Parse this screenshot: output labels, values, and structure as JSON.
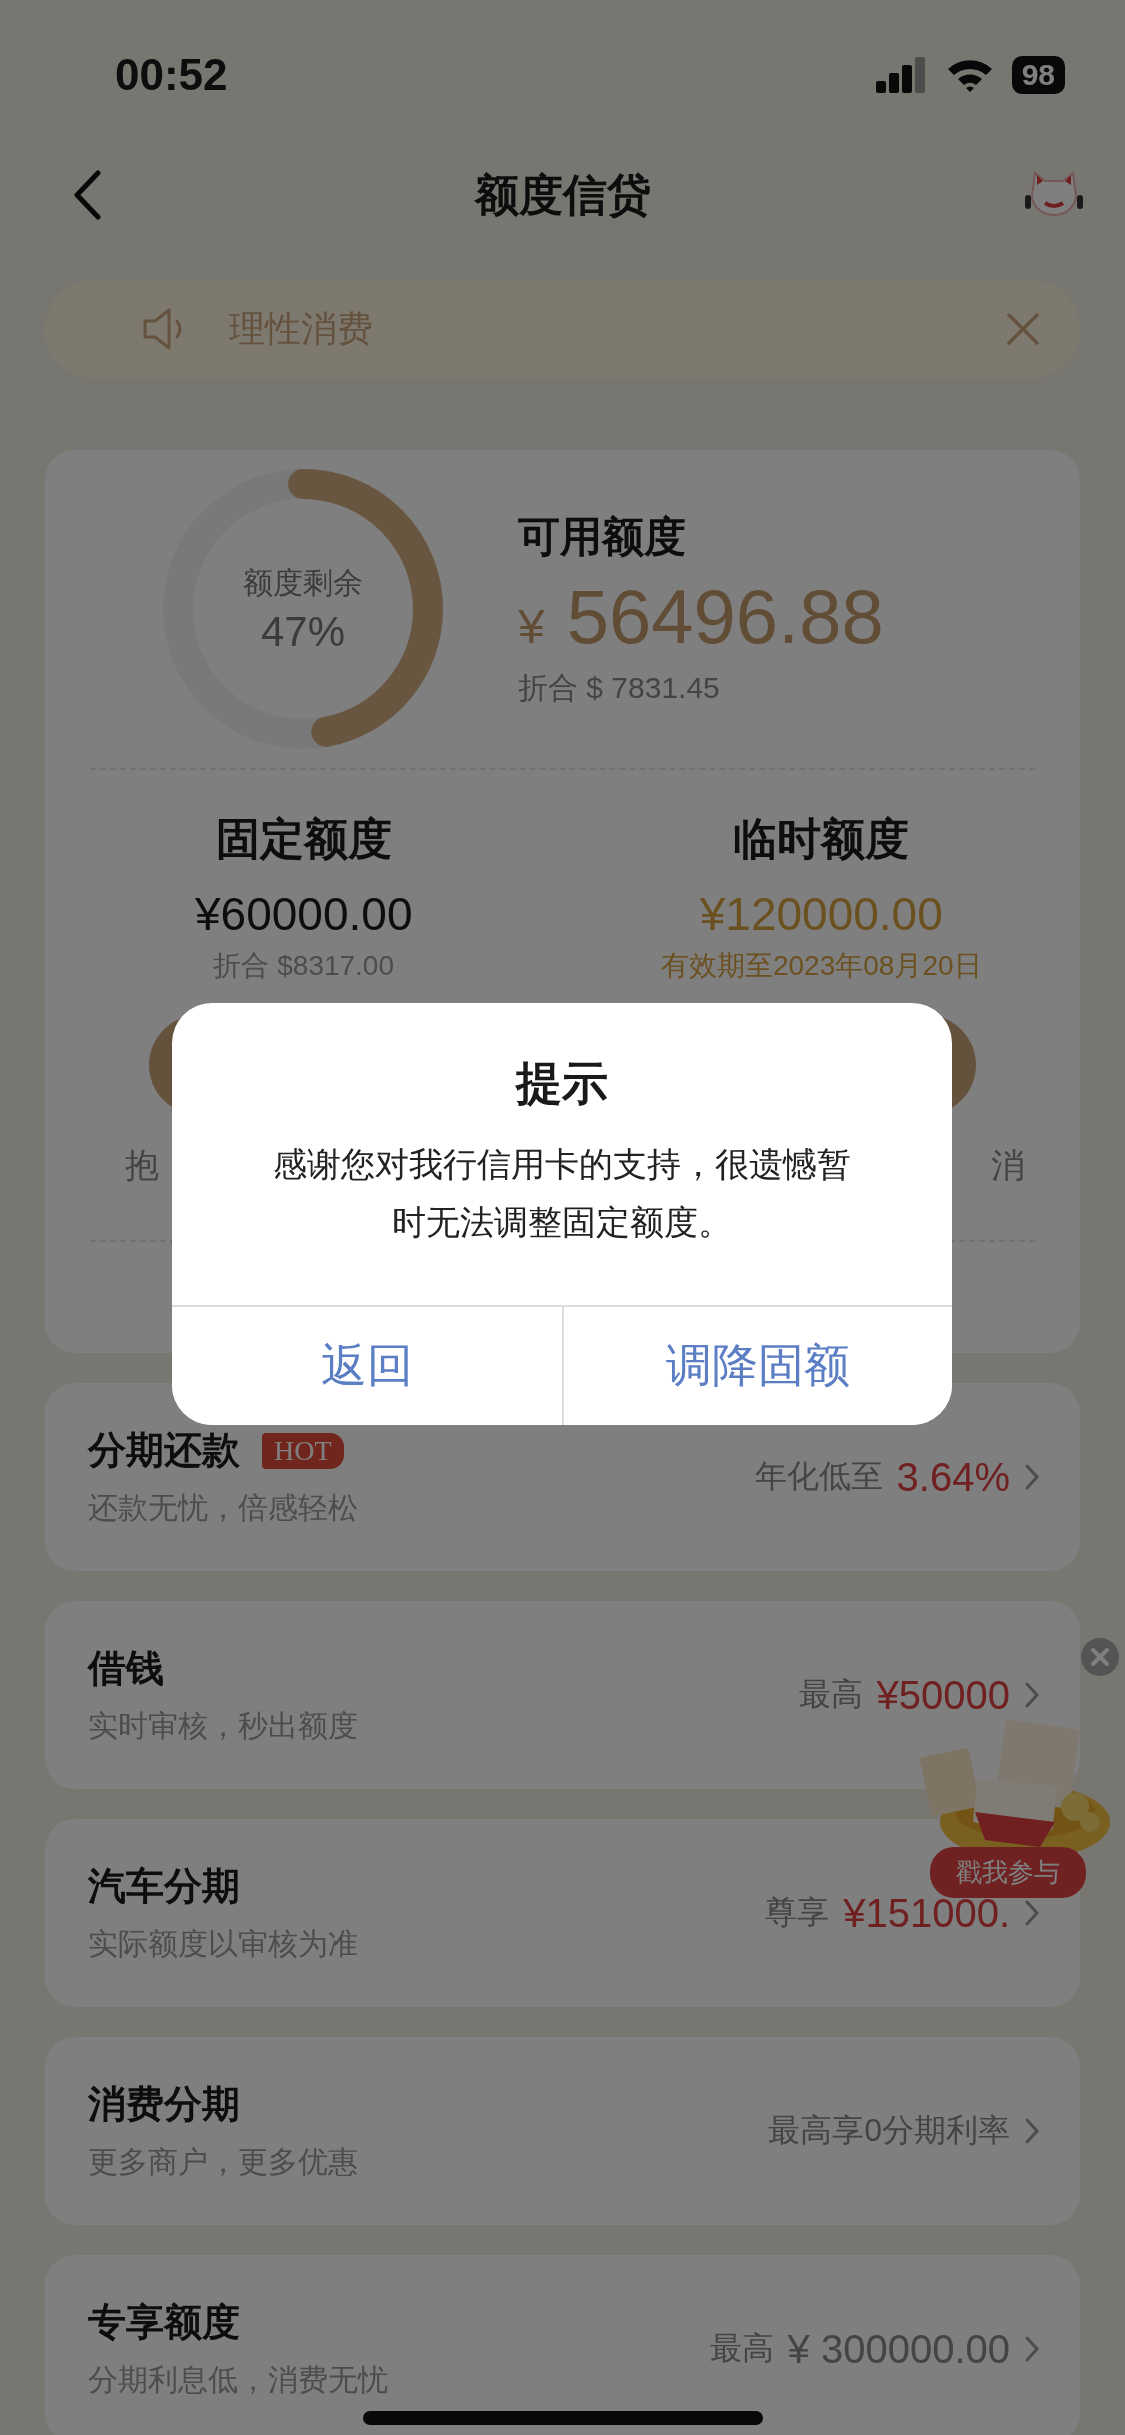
{
  "status_bar": {
    "time": "00:52",
    "battery": "98"
  },
  "header": {
    "title": "额度信贷"
  },
  "notice": {
    "text": "理性消费"
  },
  "balance": {
    "ring_label": "额度剩余",
    "ring_percent": "47%",
    "level": 0.47,
    "title": "可用额度",
    "currency": "¥",
    "amount": "56496.88",
    "converted": "折合 $ 7831.45"
  },
  "limits": [
    {
      "title": "固定额度",
      "amount": "¥60000.00",
      "note": "折合 $8317.00",
      "kind": "fixed",
      "fragment": "抱"
    },
    {
      "title": "临时额度",
      "amount": "¥120000.00",
      "note": "有效期至2023年08月20日",
      "kind": "temporary",
      "fragment": "消"
    }
  ],
  "services": [
    {
      "title": "分期还款",
      "badge": "HOT",
      "subtitle": "还款无忧，倍感轻松",
      "prefix": "年化低至",
      "value": "3.64%",
      "highlight": true
    },
    {
      "title": "借钱",
      "subtitle": "实时审核，秒出额度",
      "prefix": "最高",
      "value": "¥50000",
      "highlight": true
    },
    {
      "title": "汽车分期",
      "subtitle": "实际额度以审核为准",
      "prefix": "尊享",
      "value": "¥151000.",
      "highlight": true
    },
    {
      "title": "消费分期",
      "subtitle": "更多商户，更多优惠",
      "prefix": "最高享0分期利率"
    },
    {
      "title": "专享额度",
      "subtitle": "分期利息低，消费无忧",
      "prefix": "最高",
      "value": "¥ 300000.00",
      "highlight": false
    }
  ],
  "promo": {
    "button": "戳我参与"
  },
  "dialog": {
    "title": "提示",
    "message": "感谢您对我行信用卡的支持，很遗憾暂时无法调整固定额度。",
    "buttons": [
      "返回",
      "调降固额"
    ]
  }
}
